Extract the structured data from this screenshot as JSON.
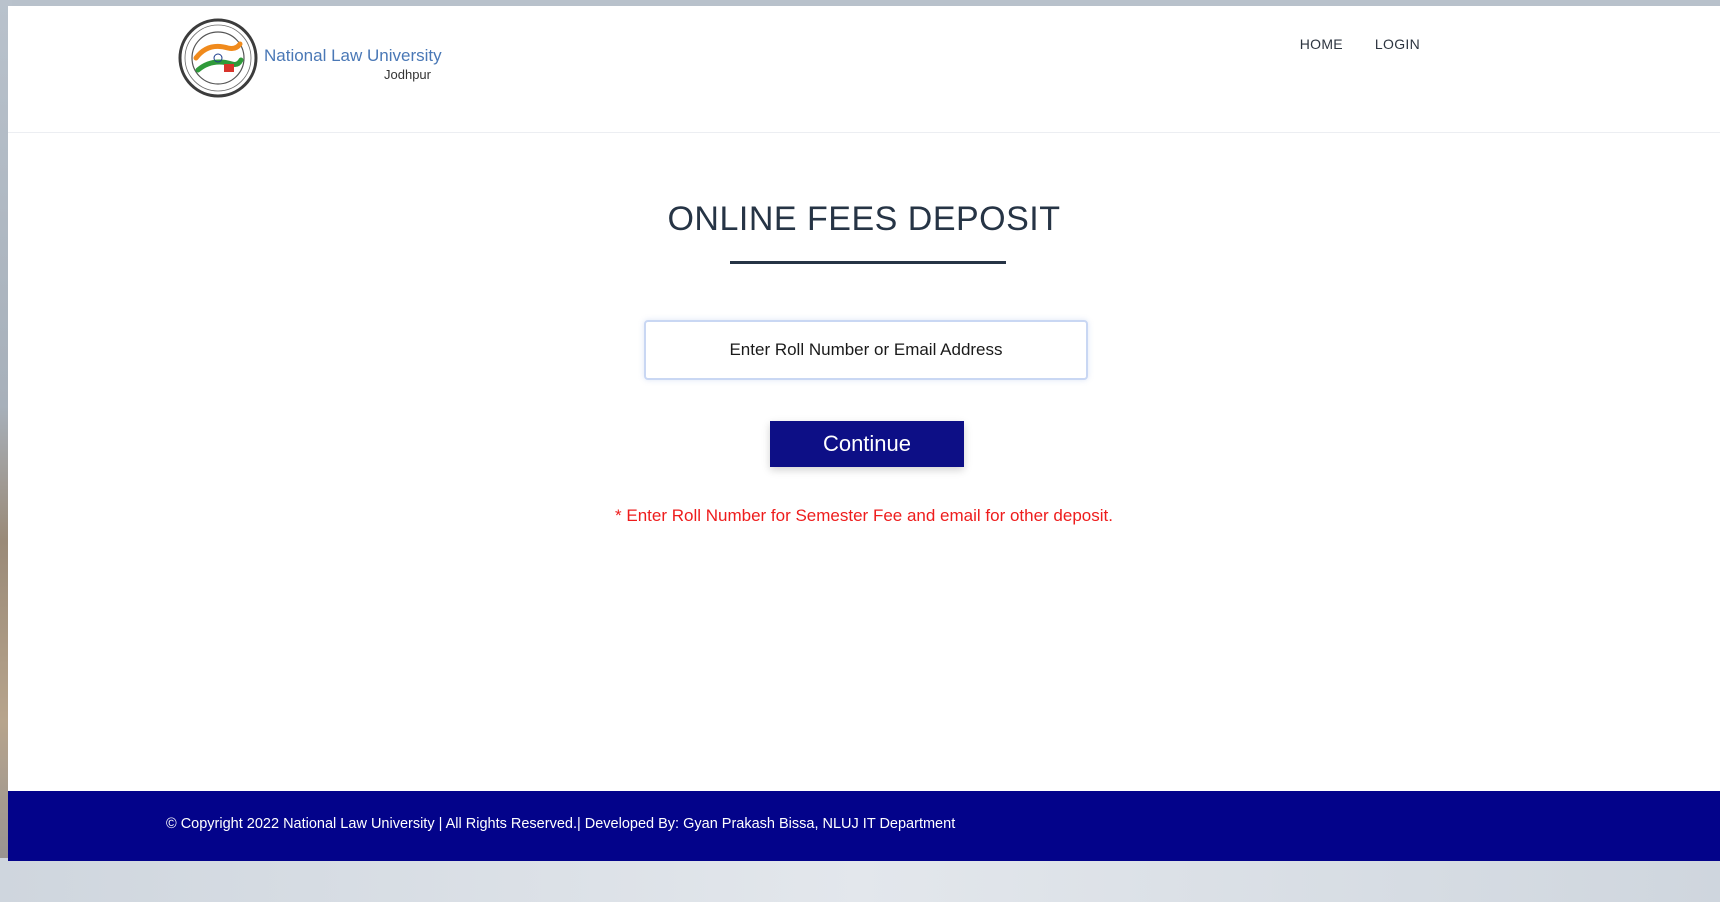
{
  "brand": {
    "name": "National Law University",
    "city": "Jodhpur"
  },
  "nav": {
    "home": "HOME",
    "login": "LOGIN"
  },
  "main": {
    "title": "ONLINE FEES DEPOSIT",
    "input_placeholder": "Enter Roll Number or Email Address",
    "input_value": "",
    "continue_label": "Continue",
    "note": "* Enter Roll Number for Semester Fee and email for other deposit."
  },
  "footer": {
    "text": "© Copyright 2022 National Law University | All Rights Reserved.| Developed By: Gyan Prakash Bissa, NLUJ IT Department"
  },
  "colors": {
    "footer_bg": "#03038a",
    "button_bg": "#0d0f86",
    "note": "#ee1c1c",
    "title": "#263445",
    "brand_text": "#4a78b6"
  },
  "icons": {
    "logo": "university-seal-icon"
  }
}
